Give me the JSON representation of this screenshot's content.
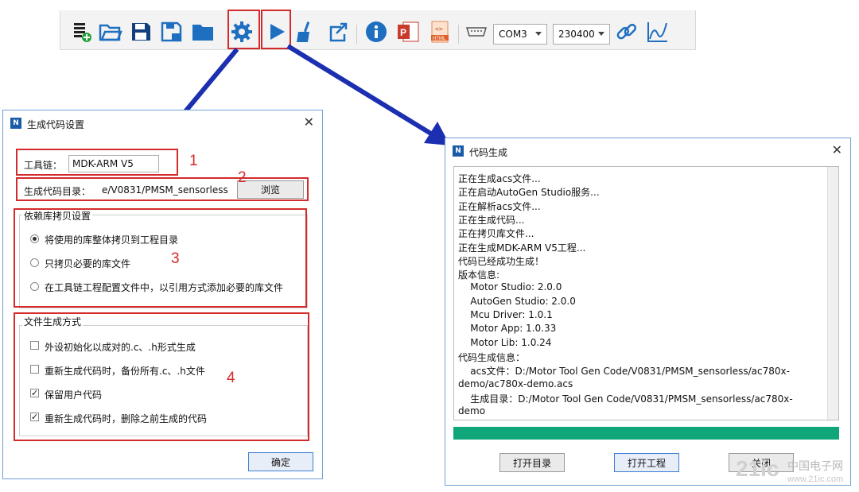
{
  "toolbar": {
    "icons": [
      "new-file-icon",
      "open-folder-icon",
      "save-icon",
      "save-as-icon",
      "folder-icon",
      "gear-icon",
      "run-icon",
      "clean-broom-icon",
      "export-icon",
      "info-icon",
      "pdf-icon",
      "html-icon",
      "serial-port-icon",
      "link-icon",
      "chart-icon"
    ],
    "com_port": "COM3",
    "baud_rate": "230400"
  },
  "annotations": [
    "1",
    "2",
    "3",
    "4"
  ],
  "settings_dialog": {
    "title": "生成代码设置",
    "close": "✕",
    "toolchain_label": "工具链：",
    "toolchain_value": "MDK-ARM V5",
    "output_label": "生成代码目录：",
    "output_value": "e/V0831/PMSM_sensorless",
    "browse": "浏览",
    "lib_group": "依赖库拷贝设置",
    "lib_options": [
      {
        "label": "将使用的库整体拷贝到工程目录",
        "selected": true
      },
      {
        "label": "只拷贝必要的库文件",
        "selected": false
      },
      {
        "label": "在工具链工程配置文件中，以引用方式添加必要的库文件",
        "selected": false
      }
    ],
    "file_group": "文件生成方式",
    "file_options": [
      {
        "label": "外设初始化以成对的.c、.h形式生成",
        "checked": false
      },
      {
        "label": "重新生成代码时，备份所有.c、.h文件",
        "checked": false
      },
      {
        "label": "保留用户代码",
        "checked": true
      },
      {
        "label": "重新生成代码时，删除之前生成的代码",
        "checked": true
      }
    ],
    "ok": "确定"
  },
  "codegen_dialog": {
    "title": "代码生成",
    "close": "✕",
    "log": [
      "正在生成acs文件...",
      "正在启动AutoGen Studio服务...",
      "正在解析acs文件...",
      "正在生成代码...",
      "正在拷贝库文件...",
      "正在生成MDK-ARM V5工程...",
      "代码已经成功生成！",
      "版本信息:",
      "    Motor Studio: 2.0.0",
      "    AutoGen Studio: 2.0.0",
      "    Mcu Driver: 1.0.1",
      "    Motor App: 1.0.33",
      "    Motor Lib: 1.0.24",
      "代码生成信息：",
      "    acs文件：D:/Motor Tool Gen Code/V0831/PMSM_sensorless/ac780x-",
      "demo/ac780x-demo.acs",
      "    生成目录：D:/Motor Tool Gen Code/V0831/PMSM_sensorless/ac780x-",
      "demo"
    ],
    "progress": 1.0,
    "open_dir": "打开目录",
    "open_project": "打开工程",
    "close_btn": "关闭"
  },
  "watermark": {
    "logo": "21ic",
    "text": "中国电子网",
    "url": "www.21ic.com"
  }
}
